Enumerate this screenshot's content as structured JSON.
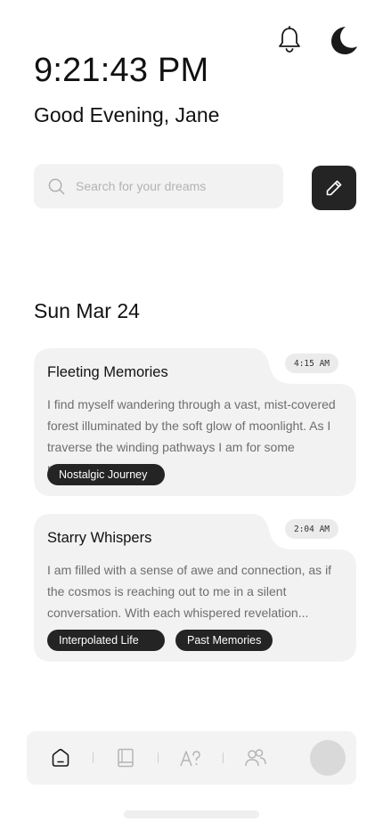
{
  "header": {
    "time": "9:21:43 PM",
    "greeting": "Good Evening, Jane"
  },
  "search": {
    "placeholder": "Search for your dreams"
  },
  "section": {
    "date": "Sun Mar 24"
  },
  "dreams": [
    {
      "title": "Fleeting Memories",
      "time": "4:15 AM",
      "excerpt": "I find myself wandering through a vast, mist-covered forest illuminated by the soft glow of moonlight. As I traverse the winding pathways I am for some reason...",
      "tags": [
        "Nostalgic Journey"
      ]
    },
    {
      "title": "Starry Whispers",
      "time": "2:04 AM",
      "excerpt": "I am filled with a sense of awe and connection, as if the cosmos is reaching out to me in a silent conversation. With each whispered revelation...",
      "tags": [
        "Interpolated Life",
        "Past Memories"
      ]
    }
  ],
  "icons": {
    "bell": "bell-icon",
    "theme": "moon-icon",
    "search": "search-icon",
    "edit": "pencil-icon",
    "nav": [
      "home-icon",
      "journal-icon",
      "dictionary-icon",
      "community-icon"
    ]
  },
  "colors": {
    "accent": "#242424",
    "surface": "#f2f2f2",
    "muted_text": "#6e6e6e"
  }
}
